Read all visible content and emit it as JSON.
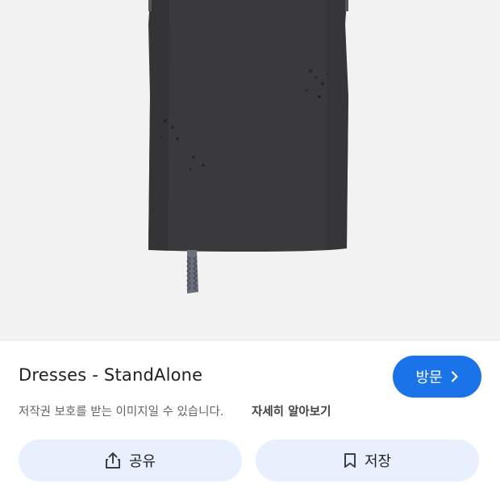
{
  "product": {
    "title": "Dresses - StandAlone",
    "image_icon": "black-skirt-image"
  },
  "visit_button": {
    "label": "방문",
    "icon": "chevron-right-icon"
  },
  "notice": {
    "copyright_text": "저작권 보호를 받는 이미지일 수 있습니다.",
    "learn_more": "자세히 알아보기"
  },
  "actions": {
    "share_label": "공유",
    "share_icon": "share-icon",
    "save_label": "저장",
    "save_icon": "bookmark-icon"
  },
  "colors": {
    "accent": "#1a73e8",
    "action_bg": "#e8f0fe",
    "image_bg": "#f2f2f2"
  }
}
